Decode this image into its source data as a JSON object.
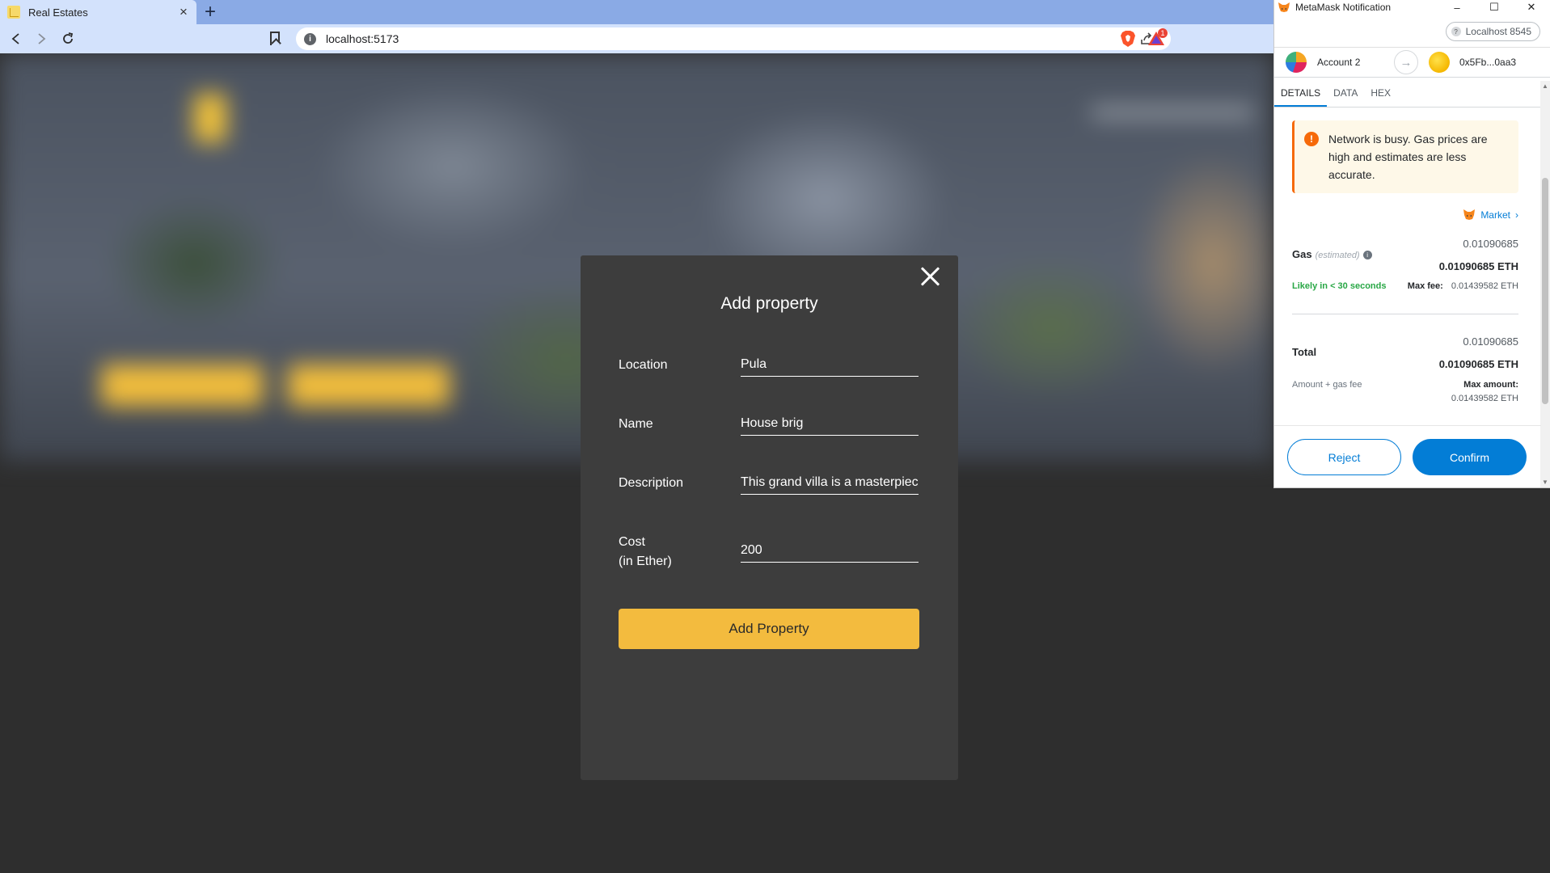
{
  "browser": {
    "tab_title": "Real Estates",
    "tab_close": "×",
    "new_tab": "+",
    "url": "localhost:5173",
    "rewards_count": "1"
  },
  "modal": {
    "close": "",
    "title": "Add property",
    "fields": {
      "location": {
        "label": "Location",
        "value": "Pula"
      },
      "name": {
        "label": "Name",
        "value": "House brig"
      },
      "description": {
        "label": "Description",
        "value": "This grand villa is a masterpiece"
      },
      "cost": {
        "label_line1": "Cost",
        "label_line2": "(in Ether)",
        "value": "200"
      }
    },
    "submit_label": "Add Property"
  },
  "metamask": {
    "window_title": "MetaMask Notification",
    "win_min": "–",
    "win_max": "☐",
    "win_close": "✕",
    "network": "Localhost 8545",
    "from_account": "Account 2",
    "to_address": "0x5Fb...0aa3",
    "tabs": [
      "DETAILS",
      "DATA",
      "HEX"
    ],
    "warning": "Network is busy. Gas prices are high and estimates are less accurate.",
    "market_label": "Market",
    "gas": {
      "label": "Gas",
      "estimated": "(estimated)",
      "fiat": "0.01090685",
      "eth": "0.01090685 ETH",
      "likely": "Likely in < 30 seconds",
      "max_fee_label": "Max fee:",
      "max_fee": "0.01439582 ETH"
    },
    "total": {
      "label": "Total",
      "fiat": "0.01090685",
      "eth": "0.01090685 ETH",
      "amount_gas": "Amount + gas fee",
      "max_amount_label": "Max amount:",
      "max_amount": "0.01439582 ETH"
    },
    "reject_label": "Reject",
    "confirm_label": "Confirm",
    "accent_color": "#037dd6"
  }
}
